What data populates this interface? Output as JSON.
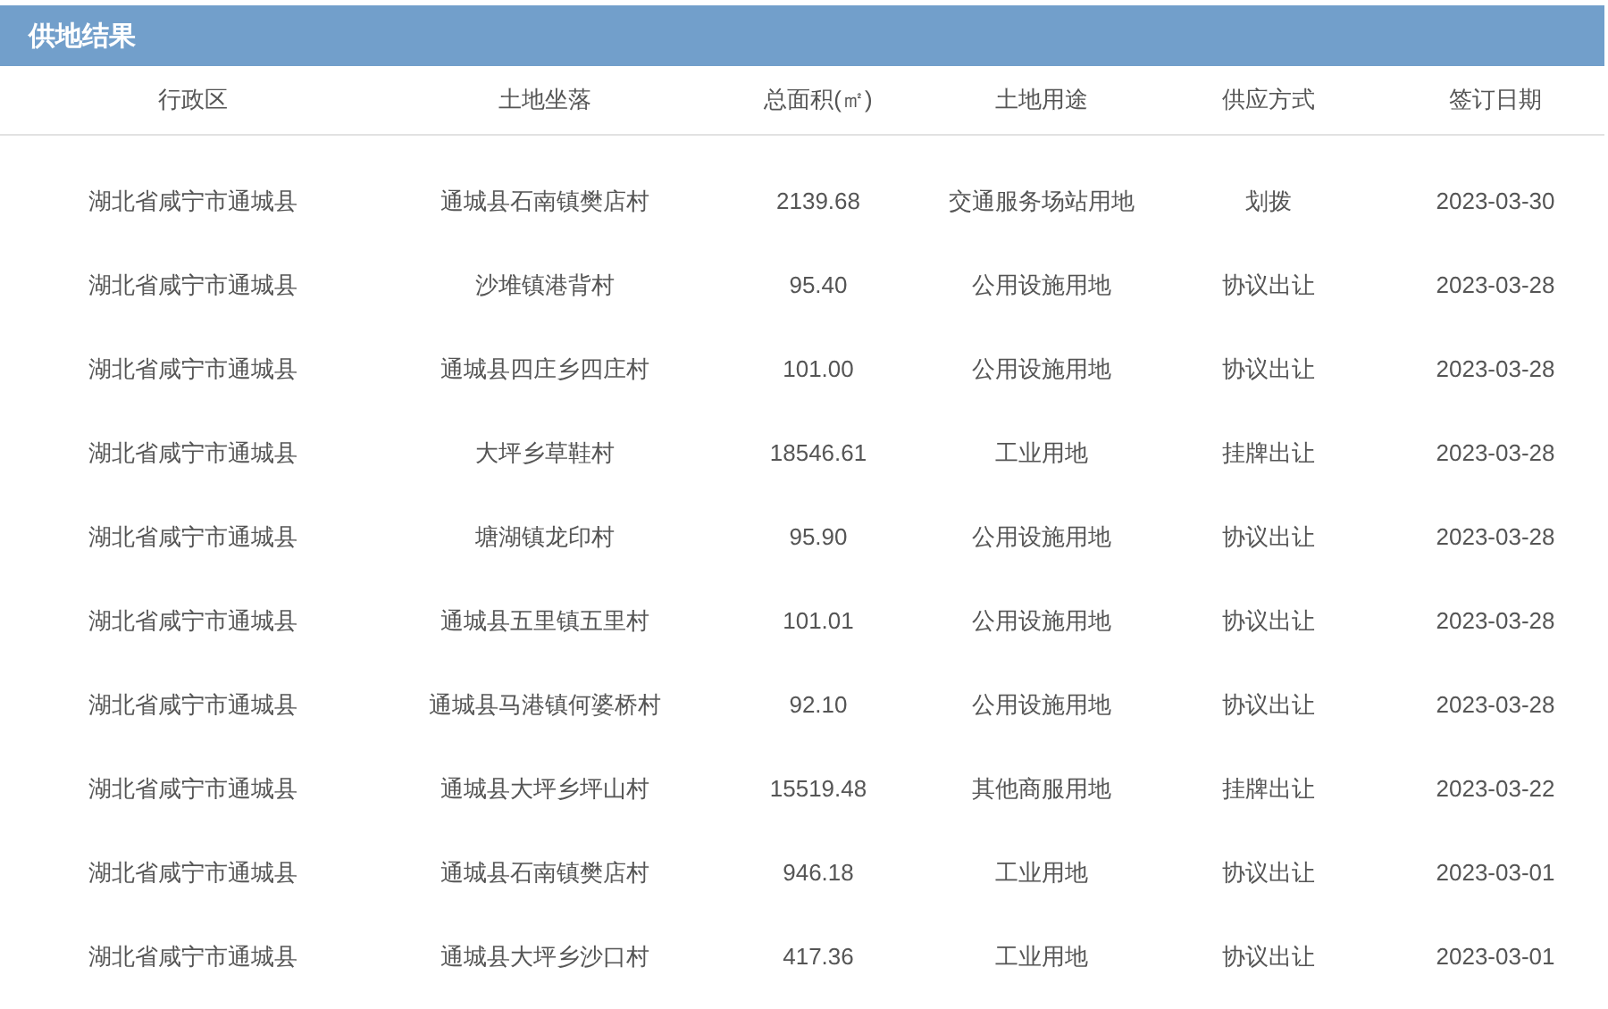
{
  "panel": {
    "title": "供地结果"
  },
  "table": {
    "columns": [
      "行政区",
      "土地坐落",
      "总面积(㎡)",
      "土地用途",
      "供应方式",
      "签订日期"
    ],
    "rows": [
      [
        "湖北省咸宁市通城县",
        "通城县石南镇樊店村",
        "2139.68",
        "交通服务场站用地",
        "划拨",
        "2023-03-30"
      ],
      [
        "湖北省咸宁市通城县",
        "沙堆镇港背村",
        "95.40",
        "公用设施用地",
        "协议出让",
        "2023-03-28"
      ],
      [
        "湖北省咸宁市通城县",
        "通城县四庄乡四庄村",
        "101.00",
        "公用设施用地",
        "协议出让",
        "2023-03-28"
      ],
      [
        "湖北省咸宁市通城县",
        "大坪乡草鞋村",
        "18546.61",
        "工业用地",
        "挂牌出让",
        "2023-03-28"
      ],
      [
        "湖北省咸宁市通城县",
        "塘湖镇龙印村",
        "95.90",
        "公用设施用地",
        "协议出让",
        "2023-03-28"
      ],
      [
        "湖北省咸宁市通城县",
        "通城县五里镇五里村",
        "101.01",
        "公用设施用地",
        "协议出让",
        "2023-03-28"
      ],
      [
        "湖北省咸宁市通城县",
        "通城县马港镇何婆桥村",
        "92.10",
        "公用设施用地",
        "协议出让",
        "2023-03-28"
      ],
      [
        "湖北省咸宁市通城县",
        "通城县大坪乡坪山村",
        "15519.48",
        "其他商服用地",
        "挂牌出让",
        "2023-03-22"
      ],
      [
        "湖北省咸宁市通城县",
        "通城县石南镇樊店村",
        "946.18",
        "工业用地",
        "协议出让",
        "2023-03-01"
      ],
      [
        "湖北省咸宁市通城县",
        "通城县大坪乡沙口村",
        "417.36",
        "工业用地",
        "协议出让",
        "2023-03-01"
      ]
    ]
  }
}
